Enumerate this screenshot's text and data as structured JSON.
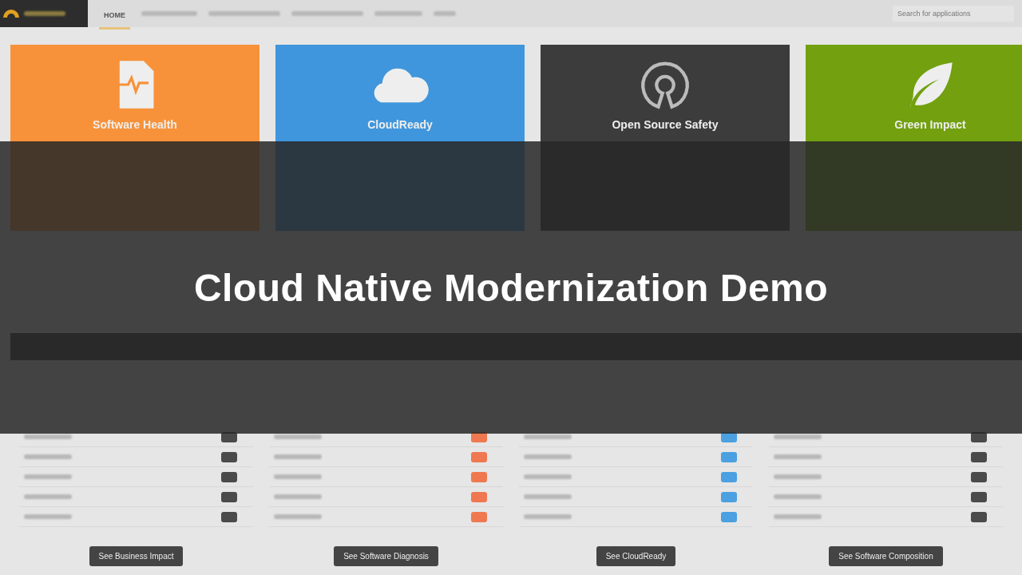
{
  "nav": {
    "tabs": [
      {
        "label": "HOME",
        "selected": true
      }
    ],
    "search": {
      "placeholder": "Search for applications"
    }
  },
  "cards": [
    {
      "title": "Software Health",
      "color": "#f7923a",
      "kind": "health"
    },
    {
      "title": "CloudReady",
      "color": "#3f96dc",
      "kind": "cloud"
    },
    {
      "title": "Open Source Safety",
      "color": "#3c3c3c",
      "kind": "opensource"
    },
    {
      "title": "Green Impact",
      "color": "#72a00e",
      "kind": "leaf"
    }
  ],
  "panels": [
    {
      "button": "See Business Impact",
      "color": "#4a4a4a"
    },
    {
      "button": "See Software Diagnosis",
      "color": "#f07850"
    },
    {
      "button": "See CloudReady",
      "color": "#4aa0e0"
    },
    {
      "button": "See Software Composition",
      "color": "#4a4a4a"
    }
  ],
  "overlay": {
    "title": "Cloud Native Modernization Demo"
  }
}
